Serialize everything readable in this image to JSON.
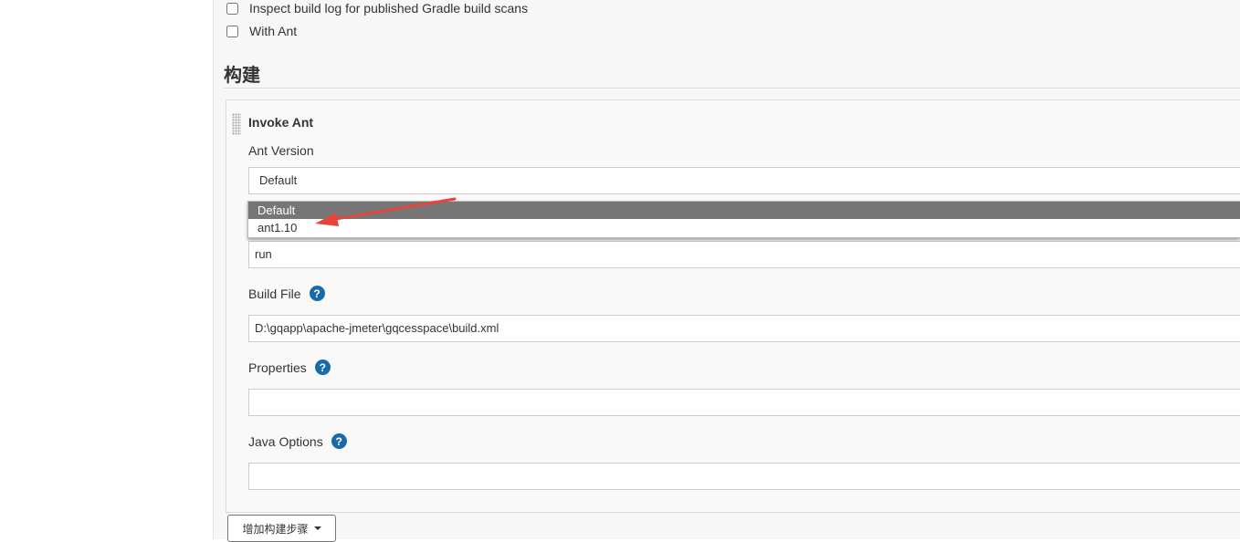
{
  "options": {
    "inspect_gradle_label": "Inspect build log for published Gradle build scans",
    "with_ant_label": "With Ant"
  },
  "section": {
    "title": "构建"
  },
  "step": {
    "title": "Invoke Ant",
    "ant_version_label": "Ant Version",
    "ant_version_value": "Default",
    "ant_version_options": [
      "Default",
      "ant1.10"
    ],
    "targets_value": "run",
    "build_file_label": "Build File",
    "build_file_value": "D:\\gqapp\\apache-jmeter\\gqcesspace\\build.xml",
    "properties_label": "Properties",
    "properties_value": "",
    "java_options_label": "Java Options",
    "java_options_value": ""
  },
  "add_step_button": "增加构建步骤",
  "colors": {
    "help_icon": "#1a6aa8",
    "annotation_arrow": "#e8443a",
    "dropdown_selected": "#767676"
  },
  "icons": [
    "help-icon",
    "chevron-down-icon",
    "drag-handle-icon",
    "arrow-annotation"
  ]
}
